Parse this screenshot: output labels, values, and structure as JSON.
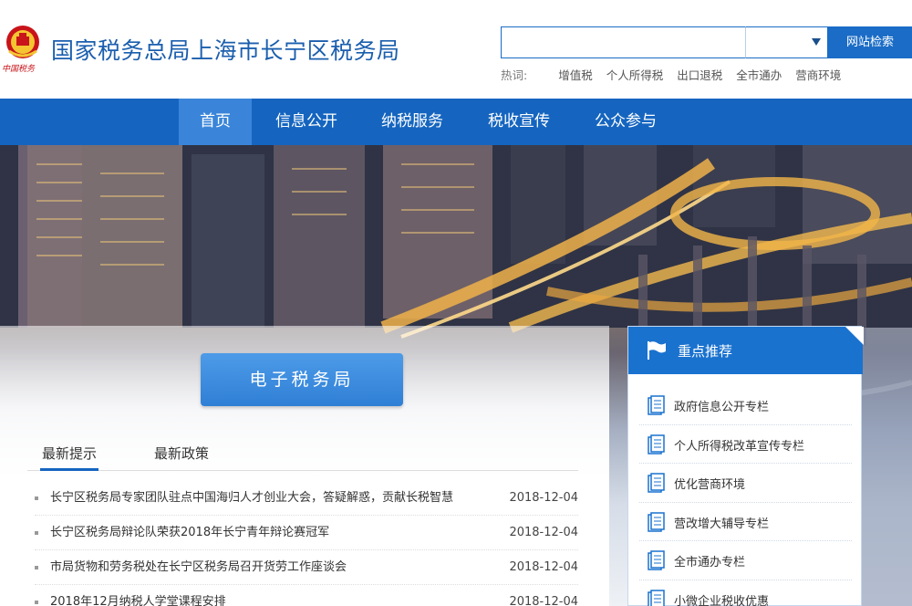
{
  "header": {
    "emblem_caption": "中国税务",
    "site_title": "国家税务总局上海市长宁区税务局",
    "search": {
      "value": "",
      "placeholder": "",
      "select_value": "",
      "button_label": "网站检索"
    },
    "hotwords_label": "热词:",
    "hotwords": [
      "增值税",
      "个人所得税",
      "出口退税",
      "全市通办",
      "营商环境"
    ]
  },
  "nav": {
    "items": [
      {
        "label": "首页",
        "active": true
      },
      {
        "label": "信息公开",
        "active": false
      },
      {
        "label": "纳税服务",
        "active": false
      },
      {
        "label": "税收宣传",
        "active": false
      },
      {
        "label": "公众参与",
        "active": false
      }
    ]
  },
  "main": {
    "etax_button": "电子税务局",
    "tabs": [
      {
        "label": "最新提示",
        "active": true
      },
      {
        "label": "最新政策",
        "active": false
      }
    ],
    "news": [
      {
        "title": "长宁区税务局专家团队驻点中国海归人才创业大会，答疑解惑，贡献长税智慧",
        "date": "2018-12-04"
      },
      {
        "title": "长宁区税务局辩论队荣获2018年长宁青年辩论赛冠军",
        "date": "2018-12-04"
      },
      {
        "title": "市局货物和劳务税处在长宁区税务局召开货劳工作座谈会",
        "date": "2018-12-04"
      },
      {
        "title": "2018年12月纳税人学堂课程安排",
        "date": "2018-12-04"
      }
    ]
  },
  "sidebar": {
    "title": "重点推荐",
    "items": [
      {
        "label": "政府信息公开专栏"
      },
      {
        "label": "个人所得税改革宣传专栏"
      },
      {
        "label": "优化营商环境"
      },
      {
        "label": "营改增大辅导专栏"
      },
      {
        "label": "全市通办专栏"
      },
      {
        "label": "小微企业税收优惠"
      }
    ]
  },
  "colors": {
    "brand_blue": "#1565c0",
    "title_blue": "#1b5fae",
    "nav_active": "#3a85d9"
  }
}
